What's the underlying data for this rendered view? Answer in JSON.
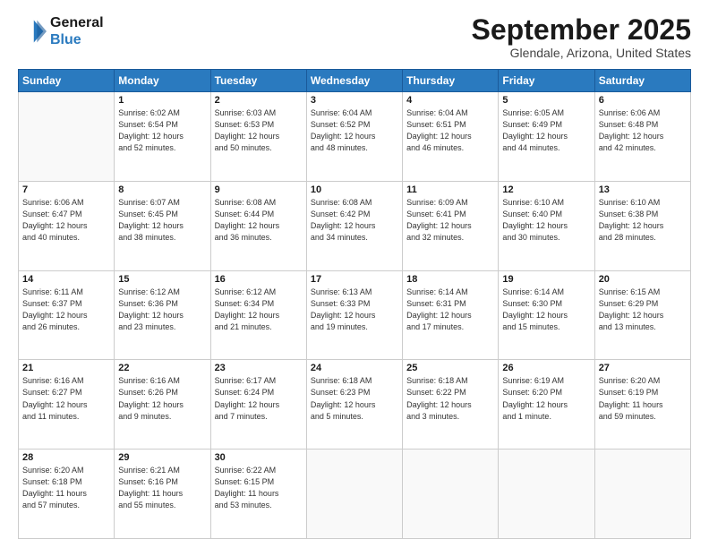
{
  "header": {
    "logo_line1": "General",
    "logo_line2": "Blue",
    "title": "September 2025",
    "subtitle": "Glendale, Arizona, United States"
  },
  "days_of_week": [
    "Sunday",
    "Monday",
    "Tuesday",
    "Wednesday",
    "Thursday",
    "Friday",
    "Saturday"
  ],
  "weeks": [
    [
      {
        "num": "",
        "detail": ""
      },
      {
        "num": "1",
        "detail": "Sunrise: 6:02 AM\nSunset: 6:54 PM\nDaylight: 12 hours\nand 52 minutes."
      },
      {
        "num": "2",
        "detail": "Sunrise: 6:03 AM\nSunset: 6:53 PM\nDaylight: 12 hours\nand 50 minutes."
      },
      {
        "num": "3",
        "detail": "Sunrise: 6:04 AM\nSunset: 6:52 PM\nDaylight: 12 hours\nand 48 minutes."
      },
      {
        "num": "4",
        "detail": "Sunrise: 6:04 AM\nSunset: 6:51 PM\nDaylight: 12 hours\nand 46 minutes."
      },
      {
        "num": "5",
        "detail": "Sunrise: 6:05 AM\nSunset: 6:49 PM\nDaylight: 12 hours\nand 44 minutes."
      },
      {
        "num": "6",
        "detail": "Sunrise: 6:06 AM\nSunset: 6:48 PM\nDaylight: 12 hours\nand 42 minutes."
      }
    ],
    [
      {
        "num": "7",
        "detail": "Sunrise: 6:06 AM\nSunset: 6:47 PM\nDaylight: 12 hours\nand 40 minutes."
      },
      {
        "num": "8",
        "detail": "Sunrise: 6:07 AM\nSunset: 6:45 PM\nDaylight: 12 hours\nand 38 minutes."
      },
      {
        "num": "9",
        "detail": "Sunrise: 6:08 AM\nSunset: 6:44 PM\nDaylight: 12 hours\nand 36 minutes."
      },
      {
        "num": "10",
        "detail": "Sunrise: 6:08 AM\nSunset: 6:42 PM\nDaylight: 12 hours\nand 34 minutes."
      },
      {
        "num": "11",
        "detail": "Sunrise: 6:09 AM\nSunset: 6:41 PM\nDaylight: 12 hours\nand 32 minutes."
      },
      {
        "num": "12",
        "detail": "Sunrise: 6:10 AM\nSunset: 6:40 PM\nDaylight: 12 hours\nand 30 minutes."
      },
      {
        "num": "13",
        "detail": "Sunrise: 6:10 AM\nSunset: 6:38 PM\nDaylight: 12 hours\nand 28 minutes."
      }
    ],
    [
      {
        "num": "14",
        "detail": "Sunrise: 6:11 AM\nSunset: 6:37 PM\nDaylight: 12 hours\nand 26 minutes."
      },
      {
        "num": "15",
        "detail": "Sunrise: 6:12 AM\nSunset: 6:36 PM\nDaylight: 12 hours\nand 23 minutes."
      },
      {
        "num": "16",
        "detail": "Sunrise: 6:12 AM\nSunset: 6:34 PM\nDaylight: 12 hours\nand 21 minutes."
      },
      {
        "num": "17",
        "detail": "Sunrise: 6:13 AM\nSunset: 6:33 PM\nDaylight: 12 hours\nand 19 minutes."
      },
      {
        "num": "18",
        "detail": "Sunrise: 6:14 AM\nSunset: 6:31 PM\nDaylight: 12 hours\nand 17 minutes."
      },
      {
        "num": "19",
        "detail": "Sunrise: 6:14 AM\nSunset: 6:30 PM\nDaylight: 12 hours\nand 15 minutes."
      },
      {
        "num": "20",
        "detail": "Sunrise: 6:15 AM\nSunset: 6:29 PM\nDaylight: 12 hours\nand 13 minutes."
      }
    ],
    [
      {
        "num": "21",
        "detail": "Sunrise: 6:16 AM\nSunset: 6:27 PM\nDaylight: 12 hours\nand 11 minutes."
      },
      {
        "num": "22",
        "detail": "Sunrise: 6:16 AM\nSunset: 6:26 PM\nDaylight: 12 hours\nand 9 minutes."
      },
      {
        "num": "23",
        "detail": "Sunrise: 6:17 AM\nSunset: 6:24 PM\nDaylight: 12 hours\nand 7 minutes."
      },
      {
        "num": "24",
        "detail": "Sunrise: 6:18 AM\nSunset: 6:23 PM\nDaylight: 12 hours\nand 5 minutes."
      },
      {
        "num": "25",
        "detail": "Sunrise: 6:18 AM\nSunset: 6:22 PM\nDaylight: 12 hours\nand 3 minutes."
      },
      {
        "num": "26",
        "detail": "Sunrise: 6:19 AM\nSunset: 6:20 PM\nDaylight: 12 hours\nand 1 minute."
      },
      {
        "num": "27",
        "detail": "Sunrise: 6:20 AM\nSunset: 6:19 PM\nDaylight: 11 hours\nand 59 minutes."
      }
    ],
    [
      {
        "num": "28",
        "detail": "Sunrise: 6:20 AM\nSunset: 6:18 PM\nDaylight: 11 hours\nand 57 minutes."
      },
      {
        "num": "29",
        "detail": "Sunrise: 6:21 AM\nSunset: 6:16 PM\nDaylight: 11 hours\nand 55 minutes."
      },
      {
        "num": "30",
        "detail": "Sunrise: 6:22 AM\nSunset: 6:15 PM\nDaylight: 11 hours\nand 53 minutes."
      },
      {
        "num": "",
        "detail": ""
      },
      {
        "num": "",
        "detail": ""
      },
      {
        "num": "",
        "detail": ""
      },
      {
        "num": "",
        "detail": ""
      }
    ]
  ]
}
